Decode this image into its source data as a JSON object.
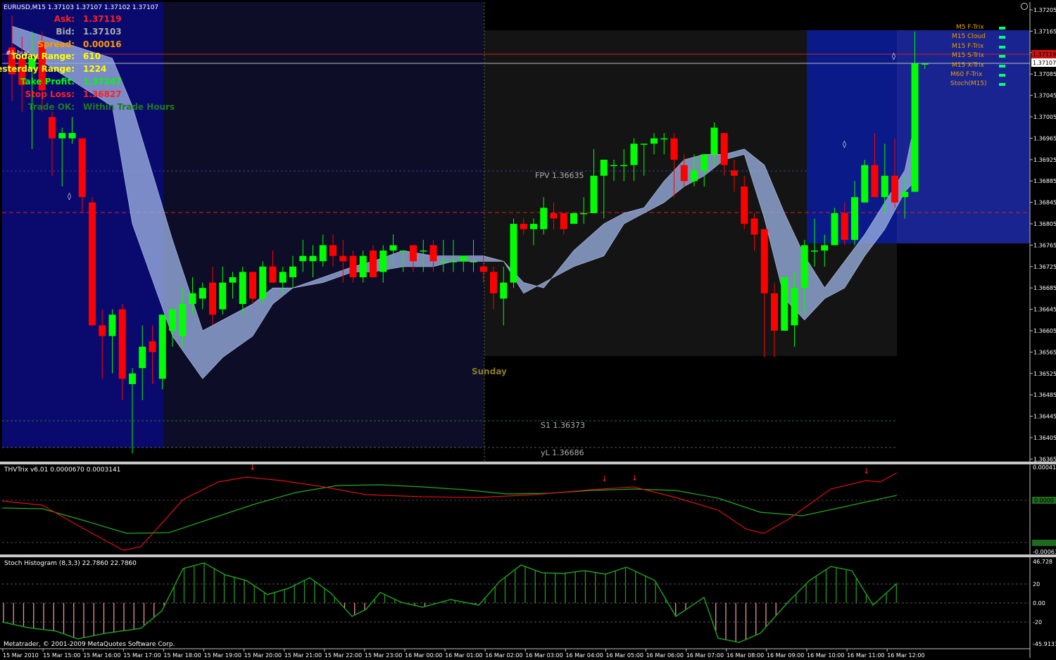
{
  "window": {
    "title": "EURUSD,M15  1.37103 1.37107 1.37102 1.37107"
  },
  "info_panel": [
    {
      "key": "Ask:",
      "value": "1.37119",
      "color": "#ff2020"
    },
    {
      "key": "Bid:",
      "value": "1.37103",
      "color": "#aaaaaa"
    },
    {
      "key": "Spread:",
      "value": "0.00016",
      "color": "#ff9900"
    },
    {
      "key": "Today Range:",
      "value": "610",
      "color": "#ffff00"
    },
    {
      "key": "Yesterday Range:",
      "value": "1224",
      "color": "#ffff00"
    },
    {
      "key": "Take Profit:",
      "value": "1.37247",
      "color": "#00ff00"
    },
    {
      "key": "Stop Loss:",
      "value": "1.36827",
      "color": "#ff2020"
    },
    {
      "key": "Trade OK:",
      "value": "Within Trade Hours",
      "color": "#1f7a1f"
    }
  ],
  "order_label": "#1 buy",
  "legend": [
    {
      "label": "M5 F-Trix"
    },
    {
      "label": "M15 Cloud"
    },
    {
      "label": "M15 F-Trix"
    },
    {
      "label": "M15 S-Trix"
    },
    {
      "label": "M15 X-Trix"
    },
    {
      "label": "M60 F-Trix"
    },
    {
      "label": "Stoch(M15)"
    }
  ],
  "annotations": {
    "sunday": "Sunday",
    "fpv": "FPV  1.36635",
    "s1": "S1  1.36373",
    "yl": "yL  1.36686"
  },
  "price_axis": {
    "labels": [
      "1.37205",
      "1.37165",
      "1.37126",
      "1.37085",
      "1.37045",
      "1.37005",
      "1.36965",
      "1.36925",
      "1.36885",
      "1.36845",
      "1.36805",
      "1.36765",
      "1.36725",
      "1.36685",
      "1.36645",
      "1.36605",
      "1.36565",
      "1.36525",
      "1.36485",
      "1.36445",
      "1.36405",
      "1.36365"
    ],
    "current_price": "1.37107",
    "ask_tag": "1.37119"
  },
  "indicators": {
    "trix_title": "THVTrix v6.01 0.0000670 0.0003141",
    "trix_axis": [
      "0.000414",
      "0.0000",
      "-0.00063"
    ],
    "trix_zero_tag": "0.0000",
    "trix_bottom_tag": "-0.00063",
    "stoch_title": "Stoch Histogram (8,3,3) 22.7860 22.7860",
    "stoch_axis": [
      "46.728",
      "20",
      "0.00",
      "-20",
      "-45.9133"
    ]
  },
  "time_axis": [
    "15 Mar 2010",
    "15 Mar 15:00",
    "15 Mar 16:00",
    "15 Mar 17:00",
    "15 Mar 18:00",
    "15 Mar 19:00",
    "15 Mar 20:00",
    "15 Mar 21:00",
    "15 Mar 22:00",
    "15 Mar 23:00",
    "16 Mar 00:00",
    "16 Mar 01:00",
    "16 Mar 02:00",
    "16 Mar 03:00",
    "16 Mar 04:00",
    "16 Mar 05:00",
    "16 Mar 06:00",
    "16 Mar 07:00",
    "16 Mar 08:00",
    "16 Mar 09:00",
    "16 Mar 10:00",
    "16 Mar 11:00",
    "16 Mar 12:00"
  ],
  "copyright": "Metatrader, © 2001-2009 MetaQuotes Software Corp.",
  "colors": {
    "bull": "#00ff00",
    "bear": "#ff0000",
    "cloud": "#9ab0e0",
    "session_blue": "#0a0a6e",
    "trix_fast": "#dd1111",
    "trix_slow": "#22aa22",
    "stoch_pos": "#1f9a1f",
    "stoch_neg": "#f09090"
  },
  "chart_data": {
    "type": "candlestick",
    "symbol": "EURUSD",
    "timeframe": "M15",
    "ylim": [
      1.36365,
      1.37225
    ],
    "candles": [
      {
        "o": 1.3714,
        "h": 1.372,
        "l": 1.3704,
        "c": 1.3709
      },
      {
        "o": 1.3712,
        "h": 1.3716,
        "l": 1.3702,
        "c": 1.3707
      },
      {
        "o": 1.371,
        "h": 1.3717,
        "l": 1.3695,
        "c": 1.3712
      },
      {
        "o": 1.3715,
        "h": 1.3717,
        "l": 1.3702,
        "c": 1.3706
      },
      {
        "o": 1.3701,
        "h": 1.3702,
        "l": 1.369,
        "c": 1.3697
      },
      {
        "o": 1.3697,
        "h": 1.3699,
        "l": 1.3688,
        "c": 1.3698
      },
      {
        "o": 1.3697,
        "h": 1.3701,
        "l": 1.3696,
        "c": 1.3698
      },
      {
        "o": 1.3697,
        "h": 1.3697,
        "l": 1.3683,
        "c": 1.3686
      },
      {
        "o": 1.3685,
        "h": 1.3686,
        "l": 1.3662,
        "c": 1.3662
      },
      {
        "o": 1.3662,
        "h": 1.3665,
        "l": 1.3652,
        "c": 1.366
      },
      {
        "o": 1.366,
        "h": 1.3665,
        "l": 1.3653,
        "c": 1.3664
      },
      {
        "o": 1.3665,
        "h": 1.3666,
        "l": 1.3648,
        "c": 1.3652
      },
      {
        "o": 1.3651,
        "h": 1.3654,
        "l": 1.3638,
        "c": 1.3653
      },
      {
        "o": 1.3654,
        "h": 1.3662,
        "l": 1.3648,
        "c": 1.3658
      },
      {
        "o": 1.3659,
        "h": 1.3662,
        "l": 1.3651,
        "c": 1.3657
      },
      {
        "o": 1.3652,
        "h": 1.3661,
        "l": 1.365,
        "c": 1.3664
      },
      {
        "o": 1.3661,
        "h": 1.3665,
        "l": 1.3658,
        "c": 1.3665
      },
      {
        "o": 1.366,
        "h": 1.3669,
        "l": 1.3658,
        "c": 1.3666
      },
      {
        "o": 1.3666,
        "h": 1.3671,
        "l": 1.3664,
        "c": 1.3668
      },
      {
        "o": 1.3667,
        "h": 1.367,
        "l": 1.3665,
        "c": 1.3669
      },
      {
        "o": 1.367,
        "h": 1.3673,
        "l": 1.3662,
        "c": 1.3664
      },
      {
        "o": 1.3665,
        "h": 1.3673,
        "l": 1.3664,
        "c": 1.367
      },
      {
        "o": 1.367,
        "h": 1.3672,
        "l": 1.3667,
        "c": 1.3671
      },
      {
        "o": 1.3666,
        "h": 1.3673,
        "l": 1.3664,
        "c": 1.3672
      },
      {
        "o": 1.3672,
        "h": 1.3672,
        "l": 1.3666,
        "c": 1.3667
      },
      {
        "o": 1.3667,
        "h": 1.3674,
        "l": 1.3666,
        "c": 1.3673
      },
      {
        "o": 1.3673,
        "h": 1.3676,
        "l": 1.367,
        "c": 1.367
      },
      {
        "o": 1.367,
        "h": 1.3673,
        "l": 1.3668,
        "c": 1.3672
      },
      {
        "o": 1.3671,
        "h": 1.3675,
        "l": 1.3669,
        "c": 1.3673
      },
      {
        "o": 1.3674,
        "h": 1.3678,
        "l": 1.3672,
        "c": 1.3675
      },
      {
        "o": 1.3674,
        "h": 1.3677,
        "l": 1.3671,
        "c": 1.3675
      },
      {
        "o": 1.3674,
        "h": 1.3679,
        "l": 1.3673,
        "c": 1.3677
      },
      {
        "o": 1.3677,
        "h": 1.3679,
        "l": 1.3673,
        "c": 1.3675
      },
      {
        "o": 1.3675,
        "h": 1.3678,
        "l": 1.367,
        "c": 1.3674
      },
      {
        "o": 1.3675,
        "h": 1.3676,
        "l": 1.367,
        "c": 1.3671
      },
      {
        "o": 1.3671,
        "h": 1.3676,
        "l": 1.367,
        "c": 1.3675
      },
      {
        "o": 1.3676,
        "h": 1.3677,
        "l": 1.3672,
        "c": 1.3671
      },
      {
        "o": 1.3672,
        "h": 1.3677,
        "l": 1.367,
        "c": 1.3676
      },
      {
        "o": 1.3676,
        "h": 1.3679,
        "l": 1.3673,
        "c": 1.3677
      },
      {
        "o": 1.3676,
        "h": 1.3676,
        "l": 1.3672,
        "c": 1.3676
      },
      {
        "o": 1.3677,
        "h": 1.3677,
        "l": 1.3672,
        "c": 1.3674
      },
      {
        "o": 1.3676,
        "h": 1.3678,
        "l": 1.3672,
        "c": 1.3676
      },
      {
        "o": 1.3677,
        "h": 1.3678,
        "l": 1.3672,
        "c": 1.3674
      },
      {
        "o": 1.3674,
        "h": 1.3678,
        "l": 1.3672,
        "c": 1.3674
      },
      {
        "o": 1.3674,
        "h": 1.3678,
        "l": 1.3672,
        "c": 1.3674
      },
      {
        "o": 1.3674,
        "h": 1.3675,
        "l": 1.3672,
        "c": 1.3675
      },
      {
        "o": 1.3674,
        "h": 1.3678,
        "l": 1.3672,
        "c": 1.3674
      },
      {
        "o": 1.3673,
        "h": 1.3675,
        "l": 1.367,
        "c": 1.3672
      },
      {
        "o": 1.3672,
        "h": 1.3673,
        "l": 1.3665,
        "c": 1.3668
      },
      {
        "o": 1.3667,
        "h": 1.3673,
        "l": 1.3662,
        "c": 1.367
      },
      {
        "o": 1.367,
        "h": 1.3682,
        "l": 1.3669,
        "c": 1.3681
      },
      {
        "o": 1.3681,
        "h": 1.3682,
        "l": 1.3679,
        "c": 1.368
      },
      {
        "o": 1.368,
        "h": 1.3682,
        "l": 1.3677,
        "c": 1.3681
      },
      {
        "o": 1.368,
        "h": 1.3686,
        "l": 1.3679,
        "c": 1.3684
      },
      {
        "o": 1.3683,
        "h": 1.3685,
        "l": 1.368,
        "c": 1.3682
      },
      {
        "o": 1.3683,
        "h": 1.3683,
        "l": 1.3679,
        "c": 1.368
      },
      {
        "o": 1.3681,
        "h": 1.3683,
        "l": 1.3681,
        "c": 1.3683
      },
      {
        "o": 1.3683,
        "h": 1.3686,
        "l": 1.3681,
        "c": 1.3683
      },
      {
        "o": 1.3683,
        "h": 1.3695,
        "l": 1.3683,
        "c": 1.369
      },
      {
        "o": 1.369,
        "h": 1.3693,
        "l": 1.3682,
        "c": 1.3693
      },
      {
        "o": 1.3692,
        "h": 1.3693,
        "l": 1.3689,
        "c": 1.3692
      },
      {
        "o": 1.3692,
        "h": 1.3695,
        "l": 1.3689,
        "c": 1.3692
      },
      {
        "o": 1.3692,
        "h": 1.3697,
        "l": 1.3689,
        "c": 1.3696
      },
      {
        "o": 1.3696,
        "h": 1.3696,
        "l": 1.369,
        "c": 1.3696
      },
      {
        "o": 1.3696,
        "h": 1.3698,
        "l": 1.3694,
        "c": 1.3697
      },
      {
        "o": 1.3697,
        "h": 1.3698,
        "l": 1.3694,
        "c": 1.3697
      },
      {
        "o": 1.3697,
        "h": 1.3698,
        "l": 1.3686,
        "c": 1.3693
      },
      {
        "o": 1.3692,
        "h": 1.3694,
        "l": 1.3688,
        "c": 1.3689
      },
      {
        "o": 1.3689,
        "h": 1.3694,
        "l": 1.3688,
        "c": 1.3691
      },
      {
        "o": 1.3691,
        "h": 1.3693,
        "l": 1.3688,
        "c": 1.3694
      },
      {
        "o": 1.3694,
        "h": 1.37,
        "l": 1.3692,
        "c": 1.3699
      },
      {
        "o": 1.3698,
        "h": 1.3698,
        "l": 1.369,
        "c": 1.3692
      },
      {
        "o": 1.3691,
        "h": 1.3693,
        "l": 1.3687,
        "c": 1.369
      },
      {
        "o": 1.3688,
        "h": 1.369,
        "l": 1.368,
        "c": 1.3681
      },
      {
        "o": 1.3682,
        "h": 1.3683,
        "l": 1.3676,
        "c": 1.3679
      },
      {
        "o": 1.368,
        "h": 1.368,
        "l": 1.3656,
        "c": 1.3668
      },
      {
        "o": 1.3668,
        "h": 1.367,
        "l": 1.3656,
        "c": 1.3661
      },
      {
        "o": 1.3661,
        "h": 1.3671,
        "l": 1.3661,
        "c": 1.3671
      },
      {
        "o": 1.3662,
        "h": 1.3672,
        "l": 1.3658,
        "c": 1.3669
      },
      {
        "o": 1.3669,
        "h": 1.3678,
        "l": 1.3664,
        "c": 1.3677
      },
      {
        "o": 1.3676,
        "h": 1.3682,
        "l": 1.3673,
        "c": 1.3676
      },
      {
        "o": 1.3676,
        "h": 1.3679,
        "l": 1.3673,
        "c": 1.3677
      },
      {
        "o": 1.3677,
        "h": 1.3684,
        "l": 1.3677,
        "c": 1.3683
      },
      {
        "o": 1.3683,
        "h": 1.3685,
        "l": 1.3677,
        "c": 1.3678
      },
      {
        "o": 1.3678,
        "h": 1.3689,
        "l": 1.3677,
        "c": 1.3686
      },
      {
        "o": 1.3685,
        "h": 1.3693,
        "l": 1.3685,
        "c": 1.3692
      },
      {
        "o": 1.3692,
        "h": 1.3698,
        "l": 1.3686,
        "c": 1.3686
      },
      {
        "o": 1.3686,
        "h": 1.3696,
        "l": 1.3683,
        "c": 1.369
      },
      {
        "o": 1.369,
        "h": 1.3697,
        "l": 1.3684,
        "c": 1.3685
      },
      {
        "o": 1.3686,
        "h": 1.369,
        "l": 1.3682,
        "c": 1.3687
      },
      {
        "o": 1.3687,
        "h": 1.3717,
        "l": 1.3687,
        "c": 1.3711
      },
      {
        "o": 1.3711,
        "h": 1.3711,
        "l": 1.371,
        "c": 1.3711
      }
    ],
    "cloud": [
      {
        "x": 0,
        "top": 1.3718,
        "bot": 1.3715
      },
      {
        "x": 10,
        "top": 1.3712,
        "bot": 1.3703
      },
      {
        "x": 12,
        "top": 1.3703,
        "bot": 1.3681
      },
      {
        "x": 16,
        "top": 1.3678,
        "bot": 1.366
      },
      {
        "x": 19,
        "top": 1.3661,
        "bot": 1.3652
      },
      {
        "x": 21,
        "top": 1.3663,
        "bot": 1.3656
      },
      {
        "x": 24,
        "top": 1.3666,
        "bot": 1.366
      },
      {
        "x": 26,
        "top": 1.3669,
        "bot": 1.3666
      },
      {
        "x": 28,
        "top": 1.3669,
        "bot": 1.3669
      },
      {
        "x": 31,
        "top": 1.3671,
        "bot": 1.367
      },
      {
        "x": 34,
        "top": 1.3673,
        "bot": 1.3672
      },
      {
        "x": 36,
        "top": 1.3674,
        "bot": 1.3672
      },
      {
        "x": 39,
        "top": 1.3676,
        "bot": 1.3673
      },
      {
        "x": 42,
        "top": 1.3675,
        "bot": 1.3673
      },
      {
        "x": 44,
        "top": 1.3675,
        "bot": 1.3674
      },
      {
        "x": 47,
        "top": 1.3675,
        "bot": 1.3674
      },
      {
        "x": 49,
        "top": 1.3674,
        "bot": 1.3674
      },
      {
        "x": 51,
        "top": 1.367,
        "bot": 1.3668
      },
      {
        "x": 53,
        "top": 1.3669,
        "bot": 1.367
      },
      {
        "x": 56,
        "top": 1.3676,
        "bot": 1.3673
      },
      {
        "x": 59,
        "top": 1.3681,
        "bot": 1.3675
      },
      {
        "x": 61,
        "top": 1.3683,
        "bot": 1.3681
      },
      {
        "x": 63,
        "top": 1.3684,
        "bot": 1.3683
      },
      {
        "x": 65,
        "top": 1.3689,
        "bot": 1.3685
      },
      {
        "x": 67,
        "top": 1.3693,
        "bot": 1.3688
      },
      {
        "x": 69,
        "top": 1.3694,
        "bot": 1.369
      },
      {
        "x": 71,
        "top": 1.3694,
        "bot": 1.3693
      },
      {
        "x": 73,
        "top": 1.3695,
        "bot": 1.3694
      },
      {
        "x": 75,
        "top": 1.3692,
        "bot": 1.3682
      },
      {
        "x": 77,
        "top": 1.3683,
        "bot": 1.3667
      },
      {
        "x": 79,
        "top": 1.3675,
        "bot": 1.3663
      },
      {
        "x": 81,
        "top": 1.3669,
        "bot": 1.3667
      },
      {
        "x": 83,
        "top": 1.3674,
        "bot": 1.3669
      },
      {
        "x": 85,
        "top": 1.3679,
        "bot": 1.3675
      },
      {
        "x": 87,
        "top": 1.3685,
        "bot": 1.368
      },
      {
        "x": 89,
        "top": 1.3691,
        "bot": 1.3687
      },
      {
        "x": 90,
        "top": 1.37,
        "bot": 1.3689
      }
    ]
  }
}
